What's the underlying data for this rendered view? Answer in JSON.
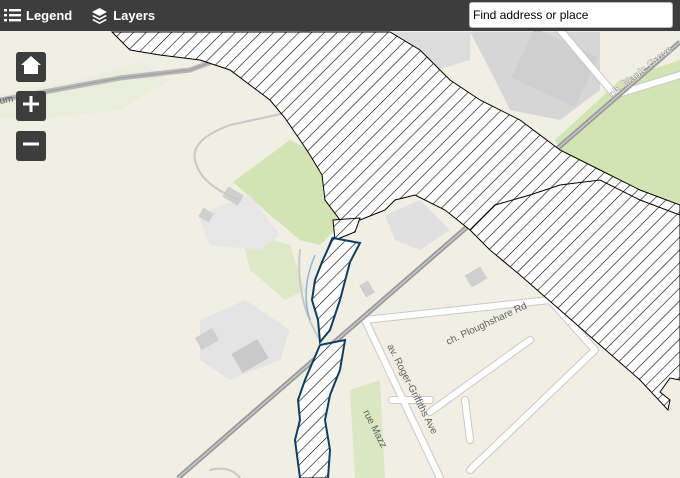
{
  "toolbar": {
    "legend_label": "Legend",
    "layers_label": "Layers",
    "search_placeholder": "Find address or place"
  },
  "controls": {
    "home_icon": "home-icon",
    "zoom_in_icon": "plus-icon",
    "zoom_out_icon": "minus-icon"
  },
  "streets": {
    "maple_grove": "ch. Maple Grove",
    "ploughshare": "ch. Ploughshare Rd",
    "roger_griffiths": "av. Roger-Griffiths Ave",
    "mazz": "rue Mazz",
    "edge_label": "um"
  },
  "colors": {
    "toolbar_bg": "#3d3d3d",
    "map_land": "#f1efe4",
    "vegetation": "#d3e4b4",
    "buildings": "#cfcfcf",
    "hatched_zone_stroke": "#000000",
    "stream_outline": "#103d62"
  }
}
